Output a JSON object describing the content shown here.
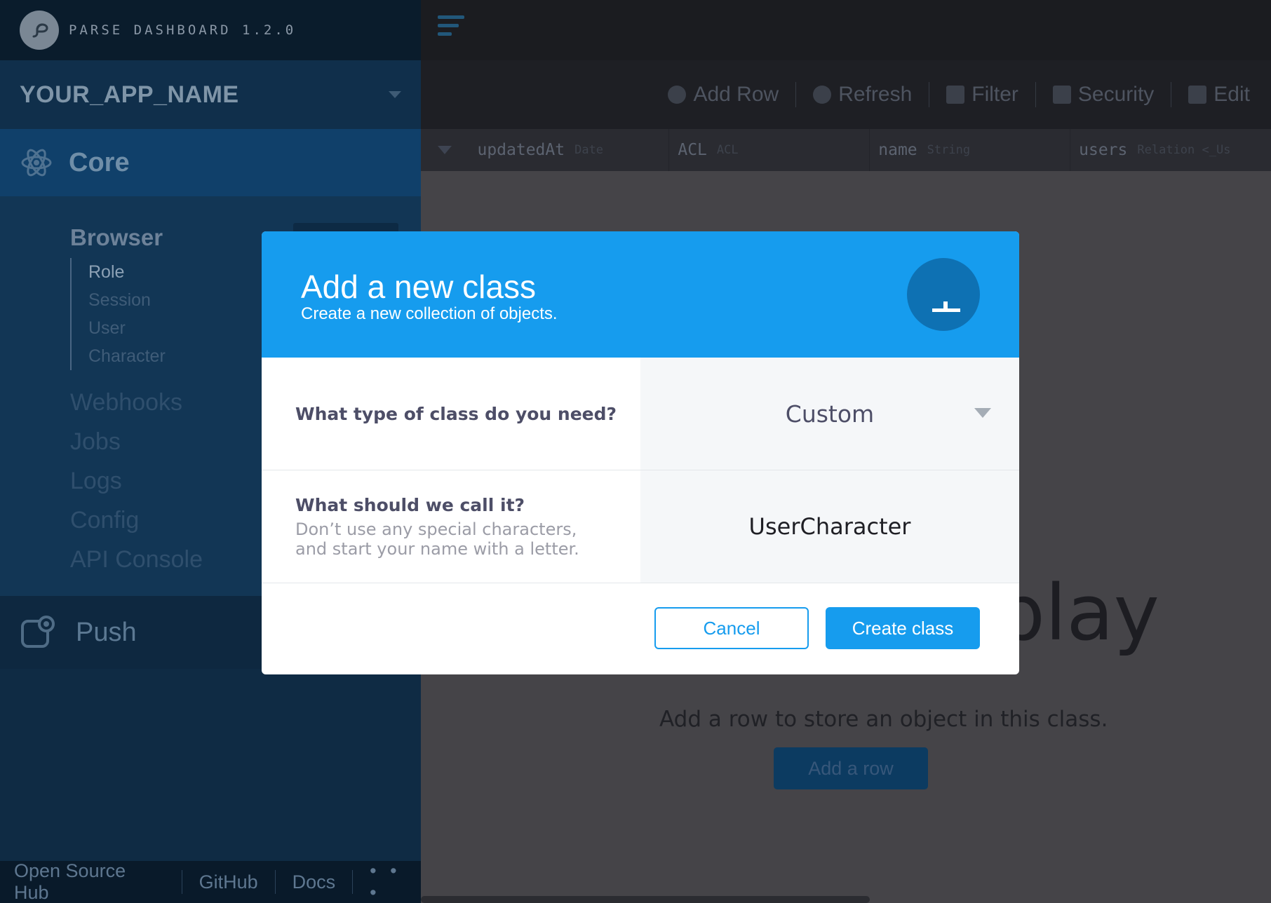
{
  "sidebar": {
    "dashboard_version": "PARSE DASHBOARD 1.2.0",
    "app_name": "YOUR_APP_NAME",
    "core": {
      "label": "Core",
      "browser_label": "Browser",
      "classes": [
        {
          "label": "Role"
        },
        {
          "label": "Session"
        },
        {
          "label": "User"
        },
        {
          "label": "Character"
        }
      ],
      "nav": [
        {
          "label": "Webhooks"
        },
        {
          "label": "Jobs"
        },
        {
          "label": "Logs"
        },
        {
          "label": "Config"
        },
        {
          "label": "API Console"
        }
      ]
    },
    "push_label": "Push",
    "footer": {
      "hub": "Open Source Hub",
      "github": "GitHub",
      "docs": "Docs",
      "more": "• • •"
    }
  },
  "toolbar": {
    "add_row": "Add Row",
    "refresh": "Refresh",
    "filter": "Filter",
    "security": "Security",
    "edit": "Edit"
  },
  "columns": [
    {
      "name": "updatedAt",
      "type": "Date"
    },
    {
      "name": "ACL",
      "type": "ACL"
    },
    {
      "name": "name",
      "type": "String"
    },
    {
      "name": "users",
      "type": "Relation <_Us"
    }
  ],
  "empty_state": {
    "title_fragment": "play",
    "description": "Add a row to store an object in this class.",
    "button": "Add a row"
  },
  "modal": {
    "title": "Add a new class",
    "subtitle": "Create a new collection of objects.",
    "type_question": "What type of class do you need?",
    "type_value": "Custom",
    "name_question": "What should we call it?",
    "name_help_line1": "Don’t use any special characters,",
    "name_help_line2": "and start your name with a letter.",
    "name_value": "UserCharacter",
    "cancel_label": "Cancel",
    "create_label": "Create class"
  },
  "colors": {
    "accent": "#169cee",
    "sidebar": "#0f2b44",
    "overlay_bg": "#454448"
  }
}
